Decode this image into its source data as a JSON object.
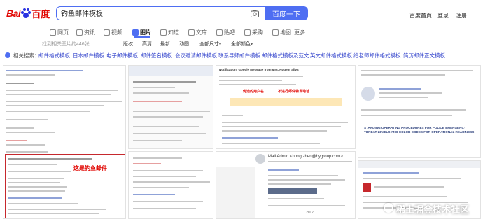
{
  "header": {
    "logo_left": "Bai",
    "logo_right": "百度",
    "search_value": "钓鱼邮件模板",
    "search_button": "百度一下",
    "links": [
      "百度首页",
      "登录",
      "注册"
    ]
  },
  "nav": {
    "tabs": [
      "网页",
      "资讯",
      "视频",
      "图片",
      "知道",
      "文库",
      "贴吧",
      "采购",
      "地图",
      "更多"
    ],
    "active": "图片"
  },
  "toolbar": {
    "count_text": "找到相关图片约446张",
    "filters": [
      "版权",
      "高清",
      "最新",
      "动图",
      "全部尺寸",
      "全部颜色"
    ]
  },
  "related": {
    "label": "相关搜索：",
    "items": [
      "邮件格式模板",
      "日本邮件模板",
      "电子邮件模板",
      "邮件签名模板",
      "会议邀请邮件模板",
      "联系导师邮件模板",
      "邮件格式模板及范文",
      "英文邮件格式模板",
      "给老师邮件格式模板",
      "简历邮件正文模板"
    ]
  },
  "thumbs": {
    "t1_redlabel": "这是钓鱼邮件",
    "t2_heading": "Notification: Google Message from Mrs. Nugent Silva",
    "t2_red1": "伪造的用户名",
    "t2_red2": "不进行邮件转发地址",
    "t3_text": "STANDING OPERATING PROCEDURES FOR POLICE EMERGENCY THREAT LEVELS AND COLOR CODES FOR OPERATIONAL READINESS",
    "t5_from": "Mail Admin <hong.zhen@hygroup.com>",
    "t5_date": "2017"
  },
  "watermark": "稀土掘金技术社区"
}
